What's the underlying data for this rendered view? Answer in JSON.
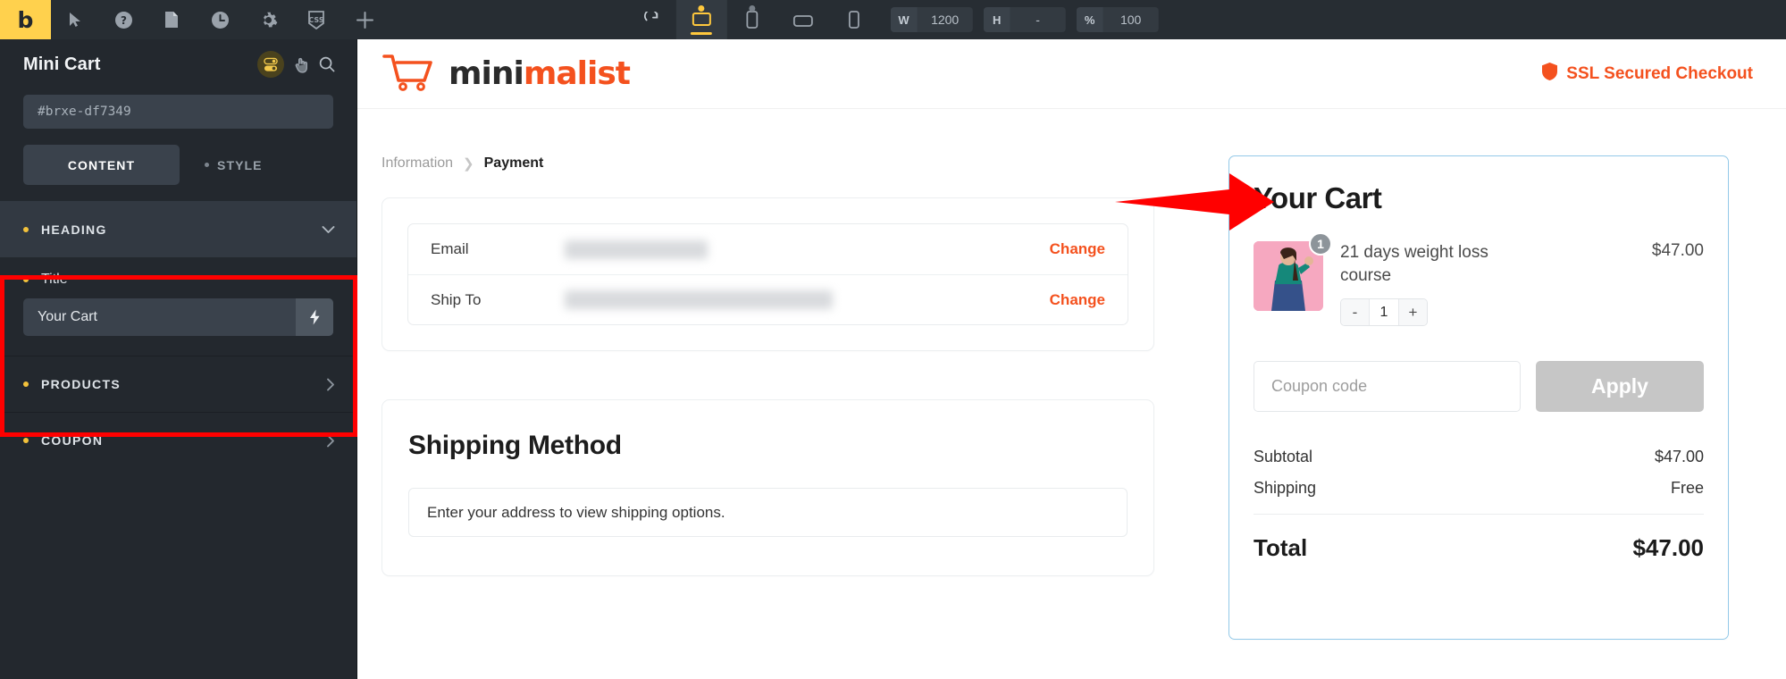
{
  "toolbar": {
    "brand": "b",
    "icons": [
      "cursor-icon",
      "help-icon",
      "page-icon",
      "history-icon",
      "settings-icon",
      "css-icon",
      "add-icon"
    ],
    "reload_icon": "reload-icon",
    "devices": [
      {
        "name": "desktop",
        "label": "Desktop",
        "active": true
      },
      {
        "name": "tablet",
        "label": "Tablet",
        "active": false
      },
      {
        "name": "tablet-landscape",
        "label": "Tablet Landscape",
        "active": false
      },
      {
        "name": "mobile",
        "label": "Mobile",
        "active": false
      }
    ],
    "width": {
      "label": "W",
      "value": "1200"
    },
    "height": {
      "label": "H",
      "value": "-"
    },
    "zoom": {
      "label": "%",
      "value": "100"
    }
  },
  "panel": {
    "title": "Mini Cart",
    "element_id": "#brxe-df7349",
    "head_icons": [
      "toggle-icon",
      "hand-pointer-icon",
      "search-icon"
    ],
    "tabs": [
      {
        "label": "CONTENT",
        "active": true
      },
      {
        "label": "STYLE",
        "active": false
      }
    ],
    "sections": [
      {
        "label": "HEADING",
        "open": true,
        "chevron": "chevron-down-icon"
      },
      {
        "label": "PRODUCTS",
        "open": false,
        "chevron": "chevron-right-icon"
      },
      {
        "label": "COUPON",
        "open": false,
        "chevron": "chevron-right-icon"
      }
    ],
    "heading_section": {
      "field_label": "Title",
      "field_value": "Your Cart",
      "dynamic_icon": "lightning-bolt-icon"
    },
    "highlight_color": "#ff0000"
  },
  "site": {
    "logo": {
      "cart_icon": "shopping-cart-icon",
      "text_part1": "mini",
      "text_part2": "malist"
    },
    "ssl": {
      "icon": "shield-icon",
      "label": "SSL Secured Checkout",
      "color": "#f4511e"
    },
    "breadcrumb": [
      {
        "label": "Information",
        "active": false
      },
      {
        "label": "Payment",
        "active": true
      }
    ],
    "info_rows": [
      {
        "key": "Email",
        "value": "",
        "action": "Change",
        "redacted": true
      },
      {
        "key": "Ship To",
        "value": "",
        "action": "Change",
        "redacted": true
      }
    ],
    "shipping": {
      "title": "Shipping Method",
      "note": "Enter your address to view shipping options."
    },
    "cart": {
      "title": "Your Cart",
      "items": [
        {
          "name": "21 days weight loss course",
          "price": "$47.00",
          "quantity": "1",
          "badge": "1",
          "minus_label": "-",
          "plus_label": "+",
          "thumb_alt": "product-thumbnail"
        }
      ],
      "coupon": {
        "placeholder": "Coupon code",
        "value": "",
        "apply_label": "Apply"
      },
      "totals": [
        {
          "label": "Subtotal",
          "value": "$47.00"
        },
        {
          "label": "Shipping",
          "value": "Free"
        }
      ],
      "grand_total": {
        "label": "Total",
        "value": "$47.00"
      }
    }
  }
}
